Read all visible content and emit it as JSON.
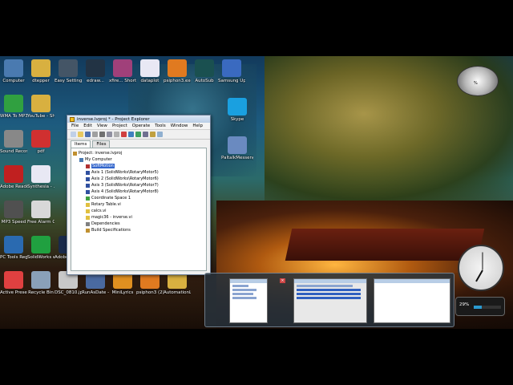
{
  "desktop": {
    "icons": [
      {
        "label": "Computer",
        "glyph": "computer-icon",
        "color": "#4a7ab0",
        "col": 0,
        "row": 0
      },
      {
        "label": "dtepper",
        "glyph": "folder-icon",
        "color": "#d8b040",
        "col": 1,
        "row": 0
      },
      {
        "label": "Easy Settings",
        "glyph": "gear-icon",
        "color": "#445566",
        "col": 2,
        "row": 0
      },
      {
        "label": "edraw...",
        "glyph": "disc-icon",
        "color": "#223344",
        "col": 3,
        "row": 0
      },
      {
        "label": "xfire... Shortcut",
        "glyph": "diamond-icon",
        "color": "#a0407a",
        "col": 4,
        "row": 0
      },
      {
        "label": "dataplot",
        "glyph": "document-icon",
        "color": "#e8e8f4",
        "col": 5,
        "row": 0
      },
      {
        "label": "psiphon3.exe",
        "glyph": "p-icon",
        "color": "#e07a20",
        "col": 6,
        "row": 0
      },
      {
        "label": "AutoSub",
        "glyph": "app-icon",
        "color": "#1a5050",
        "col": 7,
        "row": 0
      },
      {
        "label": "Samsung Update",
        "glyph": "globe-icon",
        "color": "#3a6ac0",
        "col": 8,
        "row": 0
      },
      {
        "label": "WMA To MP3",
        "glyph": "convert-icon",
        "color": "#30a040",
        "col": 0,
        "row": 1
      },
      {
        "label": "YouTube - Shortcut",
        "glyph": "folder-icon",
        "color": "#d8b040",
        "col": 1,
        "row": 1
      },
      {
        "label": "Sound Recorder",
        "glyph": "microphone-icon",
        "color": "#888888",
        "col": 0,
        "row": 2
      },
      {
        "label": "pdf",
        "glyph": "pdf-icon",
        "color": "#d03030",
        "col": 1,
        "row": 2
      },
      {
        "label": "Adobe Reader X",
        "glyph": "pdf-icon",
        "color": "#c02020",
        "col": 0,
        "row": 3
      },
      {
        "label": "Synthesia - ...",
        "glyph": "document-icon",
        "color": "#e8e8f4",
        "col": 1,
        "row": 3
      },
      {
        "label": "MP3 Speed",
        "glyph": "speed-icon",
        "color": "#505050",
        "col": 0,
        "row": 4
      },
      {
        "label": "Free Alarm Clock",
        "glyph": "clock-icon",
        "color": "#d8d8d8",
        "col": 1,
        "row": 4
      },
      {
        "label": "PC Tools Registry",
        "glyph": "gear-icon",
        "color": "#2a6ab0",
        "col": 0,
        "row": 5
      },
      {
        "label": "SolidWorks eDrawing",
        "glyph": "e-icon",
        "color": "#20a040",
        "col": 1,
        "row": 5
      },
      {
        "label": "Adobe Photosh...",
        "glyph": "ps-icon",
        "color": "#1a2a4a",
        "col": 2,
        "row": 5
      },
      {
        "label": "Active Presenter",
        "glyph": "a-icon",
        "color": "#e04040",
        "col": 0,
        "row": 6
      },
      {
        "label": "Recycle Bin",
        "glyph": "trash-icon",
        "color": "#8aa0b8",
        "col": 1,
        "row": 6
      },
      {
        "label": "DSC_0810.jpg",
        "glyph": "image-icon",
        "color": "#c8c8c8",
        "col": 2,
        "row": 6
      },
      {
        "label": "RunAsDate - Shortcut",
        "glyph": "calendar-icon",
        "color": "#4a6aa0",
        "col": 3,
        "row": 6
      },
      {
        "label": "MiniLyrics",
        "glyph": "music-icon",
        "color": "#e09020",
        "col": 4,
        "row": 6
      },
      {
        "label": "psiphon3 (2).exe",
        "glyph": "p-icon",
        "color": "#e07a20",
        "col": 5,
        "row": 6
      },
      {
        "label": "AutomationLab",
        "glyph": "folder-icon",
        "color": "#d8b040",
        "col": 6,
        "row": 6
      }
    ],
    "right_icons": [
      {
        "label": "Skype",
        "glyph": "skype-icon",
        "color": "#1aa0e0"
      },
      {
        "label": "PaltalkMessenger",
        "glyph": "chat-icon",
        "color": "#6a8ac0"
      }
    ]
  },
  "window": {
    "title": "inverse.lvproj * - Project Explorer",
    "menu": [
      "File",
      "Edit",
      "View",
      "Project",
      "Operate",
      "Tools",
      "Window",
      "Help"
    ],
    "tabs": [
      {
        "label": "Items",
        "active": true
      },
      {
        "label": "Files",
        "active": false
      }
    ],
    "tree": [
      {
        "depth": 0,
        "text": "Project: inverse.lvproj",
        "icon": "project-icon",
        "color": "#c09030",
        "selected": false
      },
      {
        "depth": 1,
        "text": "My Computer",
        "icon": "computer-icon",
        "color": "#4a7ab0",
        "selected": false
      },
      {
        "depth": 2,
        "text": "SoftMotion",
        "icon": "motion-icon",
        "color": "#b03030",
        "selected": true
      },
      {
        "depth": 2,
        "text": "Axis 1 (SolidWorks\\RotaryMotor5)",
        "icon": "axis-icon",
        "color": "#3050a0",
        "selected": false
      },
      {
        "depth": 2,
        "text": "Axis 2 (SolidWorks\\RotaryMotor6)",
        "icon": "axis-icon",
        "color": "#3050a0",
        "selected": false
      },
      {
        "depth": 2,
        "text": "Axis 3 (SolidWorks\\RotaryMotor7)",
        "icon": "axis-icon",
        "color": "#3050a0",
        "selected": false
      },
      {
        "depth": 2,
        "text": "Axis 4 (SolidWorks\\RotaryMotor8)",
        "icon": "axis-icon",
        "color": "#3050a0",
        "selected": false
      },
      {
        "depth": 2,
        "text": "Coordinate Space 1",
        "icon": "coordinate-icon",
        "color": "#40a040",
        "selected": false
      },
      {
        "depth": 2,
        "text": "Rotary Table.vi",
        "icon": "vi-icon",
        "color": "#e0c040",
        "selected": false
      },
      {
        "depth": 2,
        "text": "calcs.vi",
        "icon": "vi-icon",
        "color": "#e0c040",
        "selected": false
      },
      {
        "depth": 2,
        "text": "magic36 - inverse.vi",
        "icon": "vi-icon",
        "color": "#e0c040",
        "selected": false
      },
      {
        "depth": 2,
        "text": "Dependencies",
        "icon": "dependency-icon",
        "color": "#808080",
        "selected": false
      },
      {
        "depth": 2,
        "text": "Build Specifications",
        "icon": "build-icon",
        "color": "#c09030",
        "selected": false
      }
    ]
  },
  "gadgets": {
    "cpu_meter": {
      "label": "%"
    },
    "clock": {
      "hour_angle": 210,
      "minute_angle": 0
    },
    "battery": {
      "percent_text": "29%",
      "level": 0.29
    }
  },
  "thumbnails": [
    {
      "name": "Project Explorer thumbnail"
    },
    {
      "name": "Front Panel thumbnail"
    },
    {
      "name": "Blank Document thumbnail"
    }
  ],
  "colors": {
    "selection": "#3366cc",
    "titlebar": "#b8cde6"
  }
}
